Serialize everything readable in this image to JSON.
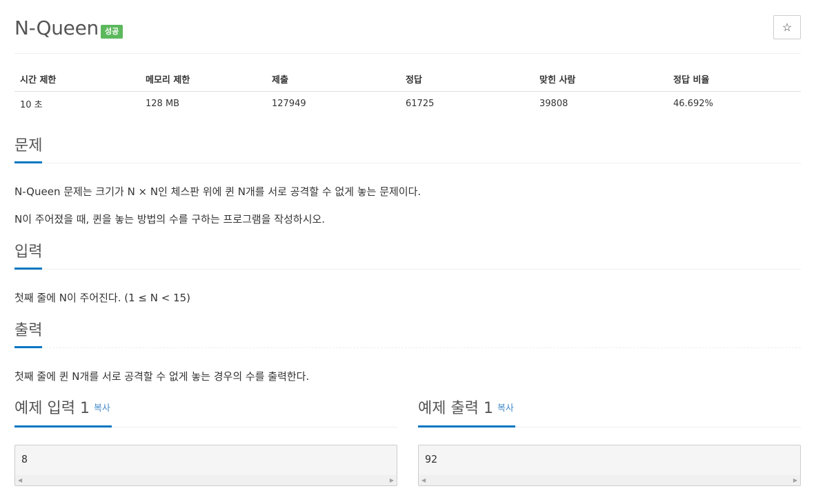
{
  "problem": {
    "title": "N-Queen",
    "badge": "성공",
    "star_icon": "☆"
  },
  "info_table": {
    "headers": [
      "시간 제한",
      "메모리 제한",
      "제출",
      "정답",
      "맞힌 사람",
      "정답 비율"
    ],
    "values": [
      "10 초",
      "128 MB",
      "127949",
      "61725",
      "39808",
      "46.692%"
    ]
  },
  "sections": {
    "problem": {
      "title": "문제",
      "lines": [
        "N-Queen 문제는 크기가 N × N인 체스판 위에 퀸 N개를 서로 공격할 수 없게 놓는 문제이다.",
        "N이 주어졌을 때, 퀸을 놓는 방법의 수를 구하는 프로그램을 작성하시오."
      ]
    },
    "input": {
      "title": "입력",
      "text": "첫째 줄에 N이 주어진다. (1 ≤ N < 15)"
    },
    "output": {
      "title": "출력",
      "text": "첫째 줄에 퀸 N개를 서로 공격할 수 없게 놓는 경우의 수를 출력한다."
    }
  },
  "samples": {
    "input": {
      "title": "예제 입력 1",
      "copy_label": "복사",
      "value": "8"
    },
    "output": {
      "title": "예제 출력 1",
      "copy_label": "복사",
      "value": "92"
    }
  },
  "colors": {
    "badge_success": "#5cb85c",
    "accent_underline": "#0076c0",
    "link": "#428bca"
  }
}
